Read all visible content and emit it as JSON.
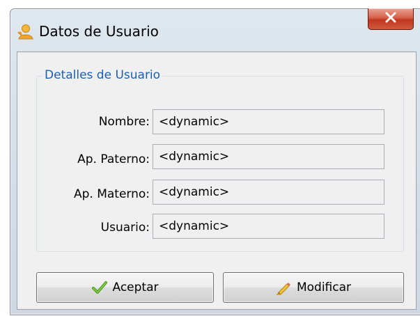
{
  "window": {
    "title": "Datos de Usuario",
    "app_icon": "user-icon",
    "close_icon": "close-icon"
  },
  "group": {
    "title": "Detalles de Usuario",
    "fields": [
      {
        "label": "Nombre:",
        "value": "<dynamic>"
      },
      {
        "label": "Ap. Paterno:",
        "value": "<dynamic>"
      },
      {
        "label": "Ap. Materno:",
        "value": "<dynamic>"
      },
      {
        "label": "Usuario:",
        "value": "<dynamic>"
      }
    ]
  },
  "buttons": {
    "accept": {
      "label": "Aceptar",
      "icon": "checkmark-icon"
    },
    "modify": {
      "label": "Modificar",
      "icon": "pencil-icon"
    }
  },
  "colors": {
    "group_title": "#1a5fb4",
    "close_button": "#c2371f"
  }
}
